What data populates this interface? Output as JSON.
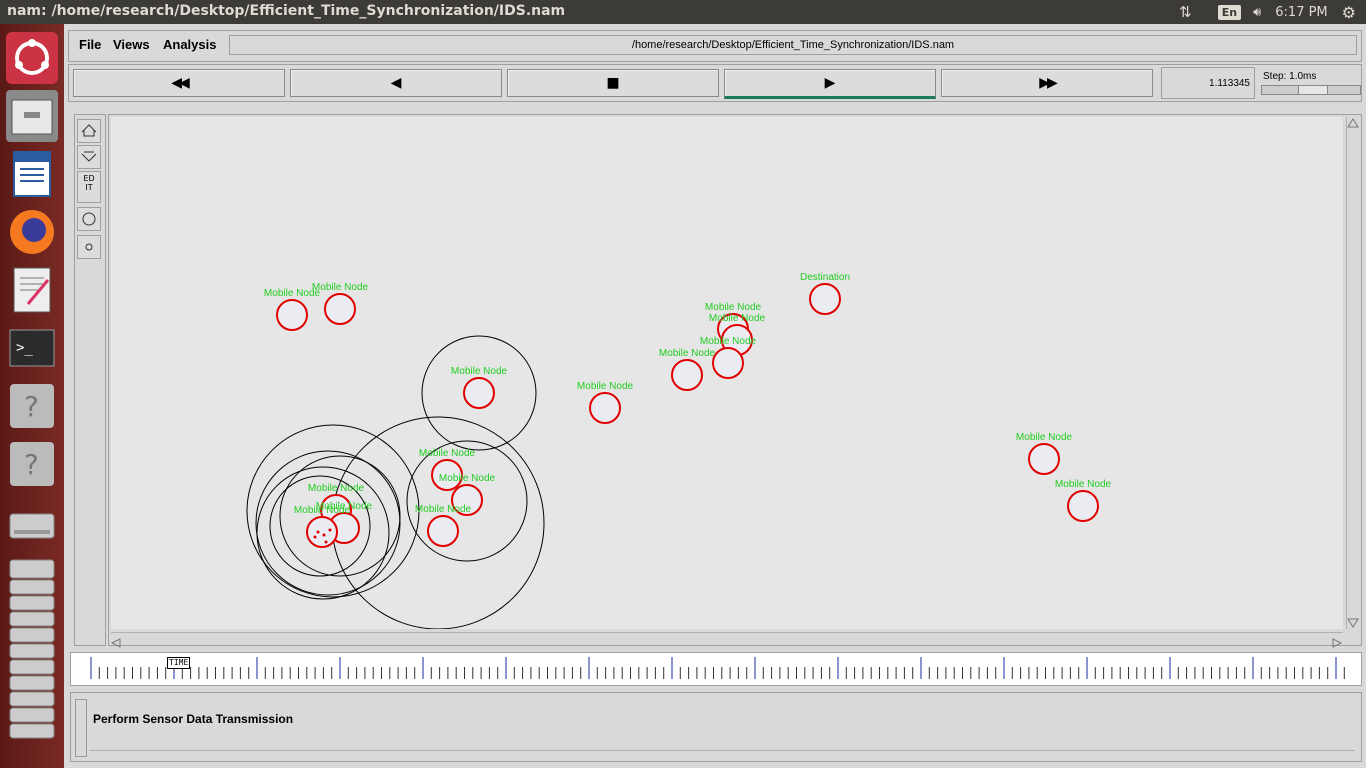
{
  "window": {
    "title": "nam: /home/research/Desktop/Efficient_Time_Synchronization/IDS.nam"
  },
  "system_tray": {
    "keyboard_layout": "En",
    "clock": "6:17 PM",
    "icons": [
      "network-icon",
      "volume-icon",
      "settings-icon"
    ]
  },
  "launcher": {
    "apps": [
      "ubuntu-dash-icon",
      "files-icon",
      "libreoffice-writer-icon",
      "firefox-icon",
      "text-editor-icon",
      "terminal-icon",
      "unknown-app-icon",
      "unknown-app-icon",
      "disk-icon",
      "disk-icon"
    ]
  },
  "menu": {
    "file": "File",
    "views": "Views",
    "analysis": "Analysis",
    "path": "/home/research/Desktop/Efficient_Time_Synchronization/IDS.nam"
  },
  "controls": {
    "rewind": "◀◀",
    "back": "◀",
    "stop": "■",
    "play": "▶",
    "fast_forward": "▶▶",
    "time": "1.113345",
    "step": "Step: 1.0ms"
  },
  "tools": {
    "edit": "EDIT"
  },
  "nodes": [
    {
      "label": "Mobile Node"
    },
    {
      "label": "Mobile Node"
    },
    {
      "label": "Destination"
    },
    {
      "label": "Mobile Node"
    },
    {
      "label": "Mobile Node"
    },
    {
      "label": "Mobile Node"
    },
    {
      "label": "Mobile Node"
    },
    {
      "label": "Mobile Node"
    },
    {
      "label": "Mobile Node"
    },
    {
      "label": "Mobile Node"
    },
    {
      "label": "Mobile Node"
    },
    {
      "label": "Mobile Node"
    },
    {
      "label": "Mobile Node"
    },
    {
      "label": "Mobile Node"
    },
    {
      "label": "Mobile Node"
    },
    {
      "label": "Mobile Node"
    },
    {
      "label": "Mobile Node"
    }
  ],
  "timeline": {
    "label": "TIME"
  },
  "annotation": {
    "text": "Perform Sensor Data Transmission"
  },
  "colors": {
    "node_stroke": "#e00000",
    "node_label": "#22cc22",
    "range_circle": "#000000"
  }
}
